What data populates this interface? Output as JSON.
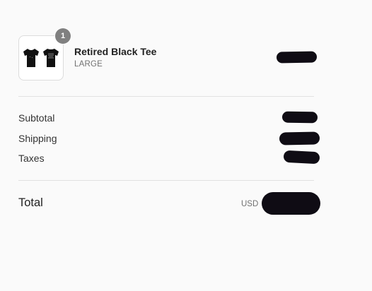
{
  "line_item": {
    "quantity": "1",
    "title": "Retired Black Tee",
    "variant": "LARGE",
    "price_redacted": true
  },
  "costs": {
    "subtotal_label": "Subtotal",
    "shipping_label": "Shipping",
    "taxes_label": "Taxes"
  },
  "total": {
    "label": "Total",
    "currency": "USD"
  },
  "colors": {
    "redaction": "#0f0c14",
    "badge": "#808080",
    "background": "#fafafa"
  },
  "icons": {
    "thumbnail": "black-tshirt-pair"
  }
}
